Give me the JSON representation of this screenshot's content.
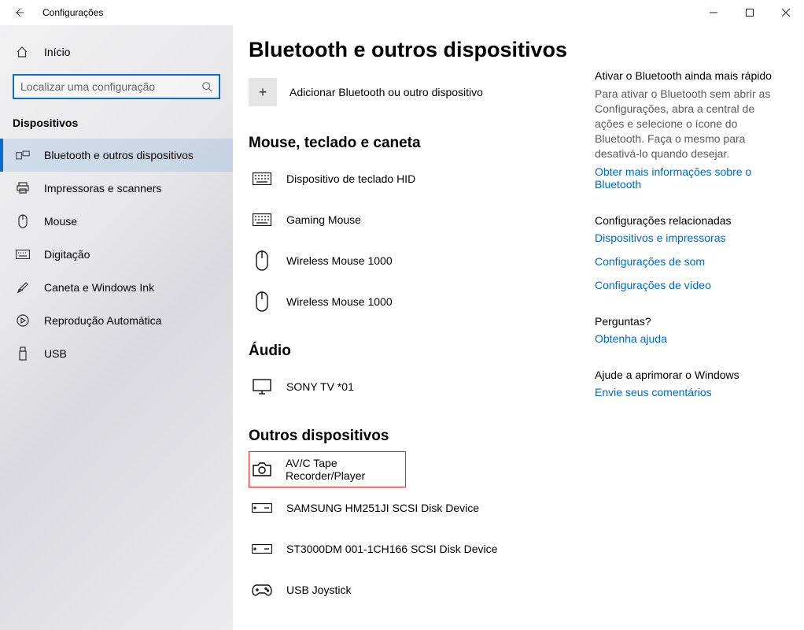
{
  "window": {
    "title": "Configurações"
  },
  "sidebar": {
    "home_label": "Início",
    "search_placeholder": "Localizar uma configuração",
    "section_title": "Dispositivos",
    "items": [
      {
        "label": "Bluetooth e outros dispositivos",
        "icon": "bluetooth-devices-icon"
      },
      {
        "label": "Impressoras e scanners",
        "icon": "printer-icon"
      },
      {
        "label": "Mouse",
        "icon": "mouse-icon"
      },
      {
        "label": "Digitação",
        "icon": "keyboard-icon"
      },
      {
        "label": "Caneta e Windows Ink",
        "icon": "pen-icon"
      },
      {
        "label": "Reprodução Automática",
        "icon": "autoplay-icon"
      },
      {
        "label": "USB",
        "icon": "usb-icon"
      }
    ]
  },
  "main": {
    "page_title": "Bluetooth e outros dispositivos",
    "add_device_label": "Adicionar Bluetooth ou outro dispositivo",
    "groups": {
      "mouse_keyboard_pen": {
        "title": "Mouse, teclado e caneta",
        "items": [
          {
            "label": "Dispositivo de teclado HID",
            "icon": "keyboard-device-icon"
          },
          {
            "label": "Gaming Mouse",
            "icon": "keyboard-device-icon"
          },
          {
            "label": "Wireless Mouse 1000",
            "icon": "mouse-outline-icon"
          },
          {
            "label": "Wireless Mouse 1000",
            "icon": "mouse-outline-icon"
          }
        ]
      },
      "audio": {
        "title": "Áudio",
        "items": [
          {
            "label": "SONY TV  *01",
            "icon": "monitor-icon"
          }
        ]
      },
      "other": {
        "title": "Outros dispositivos",
        "items": [
          {
            "label": "AV/C Tape Recorder/Player",
            "icon": "camera-icon",
            "highlight": true
          },
          {
            "label": "SAMSUNG HM251JI SCSI Disk Device",
            "icon": "disk-icon"
          },
          {
            "label": "ST3000DM 001-1CH166 SCSI Disk Device",
            "icon": "disk-icon"
          },
          {
            "label": "USB Joystick",
            "icon": "gamepad-icon"
          }
        ]
      }
    }
  },
  "right": {
    "bt_faster": {
      "title": "Ativar o Bluetooth ainda mais rápido",
      "body": "Para ativar o Bluetooth sem abrir as Configurações, abra a central de ações e selecione o ícone do Bluetooth. Faça o mesmo para desativá-lo quando desejar.",
      "link": "Obter mais informações sobre o Bluetooth"
    },
    "related": {
      "title": "Configurações relacionadas",
      "links": [
        "Dispositivos e impressoras",
        "Configurações de som",
        "Configurações de vídeo"
      ]
    },
    "questions": {
      "title": "Perguntas?",
      "link": "Obtenha ajuda"
    },
    "improve": {
      "title": "Ajude a aprimorar o Windows",
      "link": "Envie seus comentários"
    }
  }
}
